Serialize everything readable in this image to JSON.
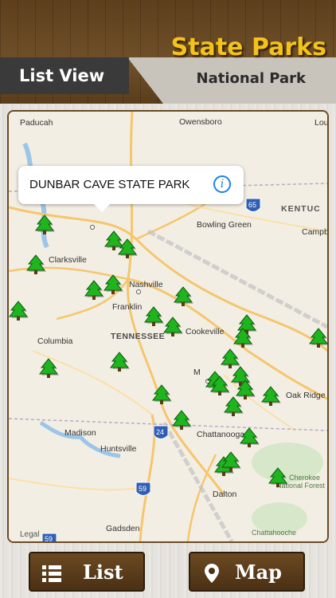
{
  "header": {
    "app_title": "State Parks",
    "subtitle": "National Park",
    "list_view_label": "List View"
  },
  "map": {
    "callout_label": "DUNBAR CAVE STATE PARK",
    "legal_label": "Legal",
    "state_label": "TENNESSEE",
    "cities": [
      "Paducah",
      "Owensboro",
      "Lou",
      "KENTUC",
      "Bowling Green",
      "Campb",
      "Clarksville",
      "Nashville",
      "Franklin",
      "Cookeville",
      "Columbia",
      "Oak Ridge",
      "Madison",
      "Huntsville",
      "Chattanooga",
      "Cherokee",
      "National Forest",
      "Dalton",
      "Gadsden",
      "Chattahooche",
      "M"
    ],
    "highway_shields": [
      "65",
      "24",
      "59",
      "59"
    ],
    "park_markers_count": 33,
    "colors": {
      "park_marker": "#1fb51f",
      "info_blue": "#1a82e8",
      "title_yellow": "#f4c21a"
    }
  },
  "buttons": {
    "list_label": "List",
    "map_label": "Map"
  }
}
